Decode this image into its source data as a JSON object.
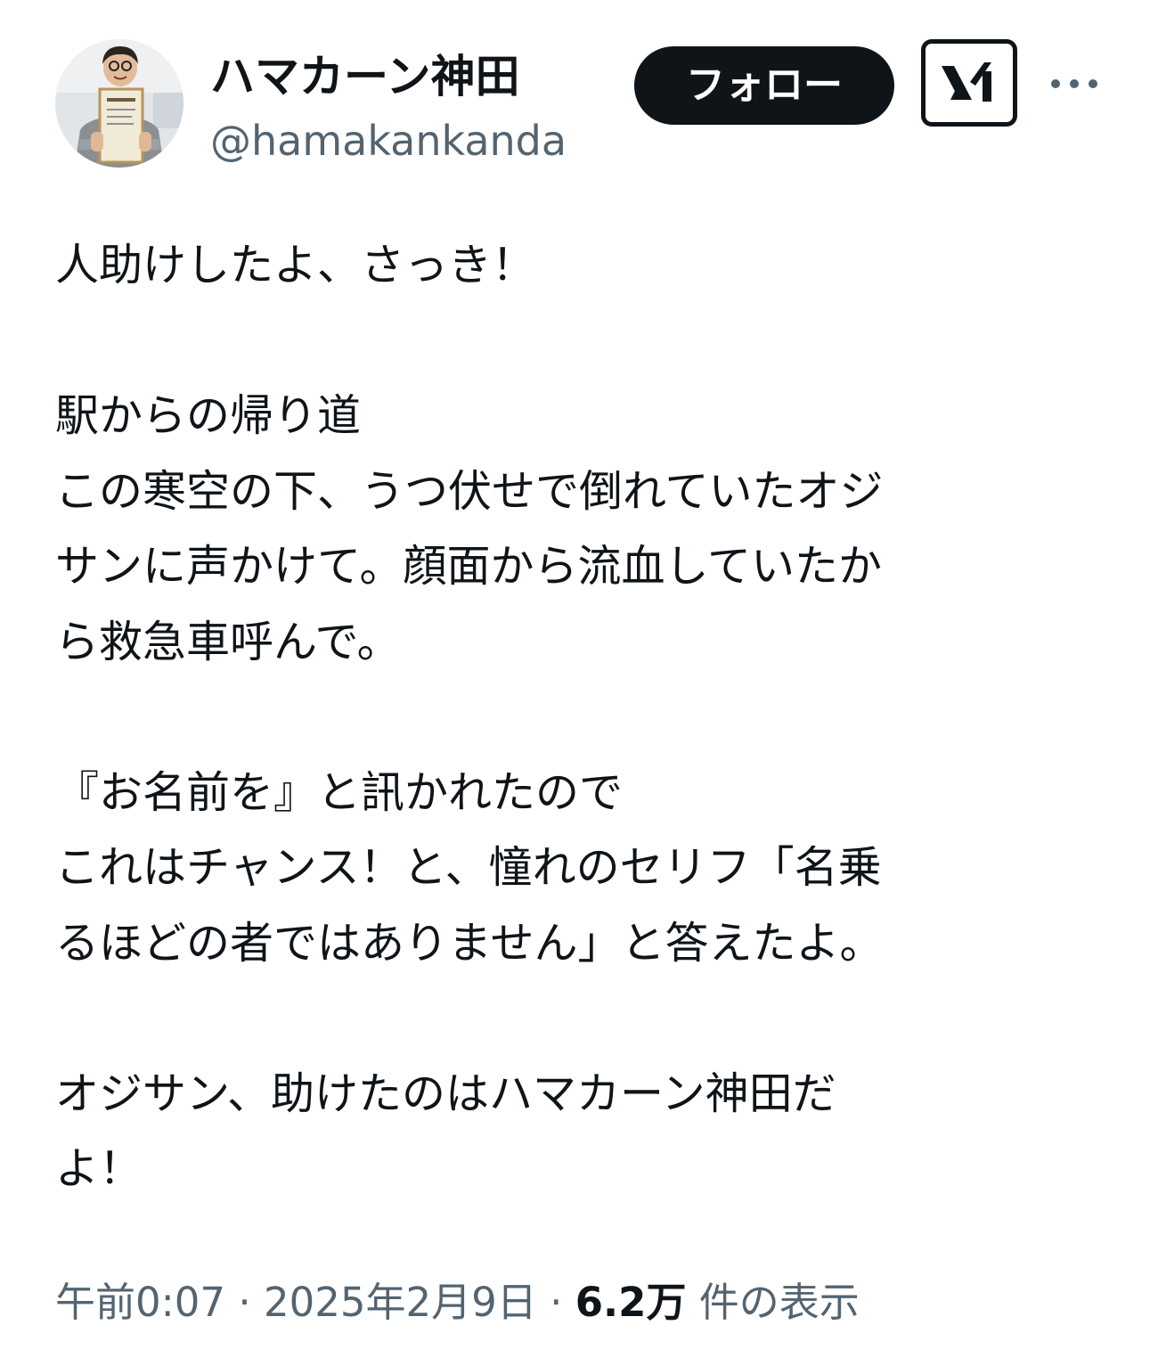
{
  "author": {
    "display_name": "ハマカーン神田",
    "handle": "@hamakankanda"
  },
  "actions": {
    "follow_label": "フォロー"
  },
  "tweet": {
    "lines": [
      "人助けしたよ、さっき！",
      "",
      "駅からの帰り道",
      "この寒空の下、うつ伏せで倒れていたオジ",
      "サンに声かけて。顔面から流血していたか",
      "ら救急車呼んで。",
      "",
      "『お名前を』と訊かれたので",
      "これはチャンス！と、憧れのセリフ「名乗",
      "るほどの者ではありません」と答えたよ。",
      "",
      "オジサン、助けたのはハマカーン神田だ",
      "よ！"
    ]
  },
  "meta": {
    "time": "午前0:07",
    "separator": "·",
    "date": "2025年2月9日",
    "views_count": "6.2万",
    "views_label": "件の表示"
  },
  "icons": {
    "grok": "grok-icon",
    "more": "more-options-icon"
  },
  "colors": {
    "text_primary": "#0f1419",
    "text_secondary": "#536471",
    "follow_bg": "#0f1419",
    "follow_text": "#ffffff"
  }
}
